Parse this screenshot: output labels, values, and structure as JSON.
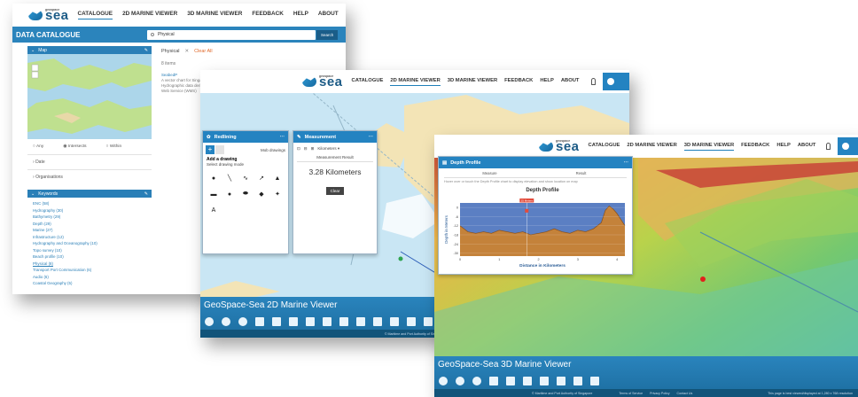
{
  "logo": {
    "small": "geospace",
    "big": "sea"
  },
  "nav": {
    "catalogue": "CATALOGUE",
    "viewer2d": "2D MARINE VIEWER",
    "viewer3d": "3D MARINE VIEWER",
    "feedback": "FEEDBACK",
    "help": "HELP",
    "about": "ABOUT"
  },
  "catalogue": {
    "title": "DATA CATALOGUE",
    "search_value": "Physical",
    "search_button": "Search",
    "filter_chip": "Physical",
    "clear_all": "Clear All",
    "items_count": "8 items",
    "result_title": "SeabedP",
    "result_lines": [
      "A vector chart for Singapore port",
      "Hydrographic data derived",
      "Web Service (WMS)"
    ],
    "map_section": "Map",
    "radio_any": "Any",
    "radio_intersects": "Intersects",
    "radio_within": "Within",
    "date_section": "Date",
    "org_section": "Organisations",
    "keywords_section": "Keywords",
    "keywords": [
      "ENC (58)",
      "Hydrography (30)",
      "Bathymetry (29)",
      "Depth (29)",
      "Marine (27)",
      "Infrastructure (12)",
      "Hydrography and Oceanography (10)",
      "Topo survey (10)",
      "Beach profile (10)",
      "Physical (8)",
      "Transport Port Communication (6)",
      "Audio (6)",
      "Coastal Geography (5)"
    ]
  },
  "viewer2d": {
    "title": "GeoSpace-Sea 2D Marine Viewer",
    "redlining": {
      "title": "Redlining",
      "my_drawings": "Mob drawings",
      "add": "Add a drawing",
      "mode": "Select drawing mode"
    },
    "measurement": {
      "title": "Measurement",
      "unit": "Kilometers",
      "result_label": "Measurement Result",
      "result": "3.28 Kilometers",
      "clear": "Clear"
    },
    "footer": "© Maritime and Port Authority of Singapore"
  },
  "viewer3d": {
    "title": "GeoSpace-Sea 3D Marine Viewer",
    "depth": {
      "panel_title": "Depth Profile",
      "col_measure": "Measure",
      "col_result": "Result",
      "hint": "Hover over or touch the Depth Profile chart to display elevation and show location on map",
      "chart_title": "Depth Profile",
      "xlabel": "Distance in Kilometers",
      "ylabel": "Depth in Meters",
      "marker_label": "25 Meters"
    },
    "footer_left": "© Maritime and Port Authority of Singapore",
    "footer_links": [
      "Terms of Service",
      "Privacy Policy",
      "Contact Us"
    ],
    "footer_right": "This page is best viewed/displayed at 1,280 x 768 resolution"
  },
  "chart_data": {
    "type": "area",
    "title": "Depth Profile",
    "xlabel": "Distance in Kilometers",
    "ylabel": "Depth in Meters",
    "x_ticks": [
      0,
      1,
      2,
      3,
      4
    ],
    "y_ticks": [
      0,
      -6,
      -12,
      -18,
      -24,
      -30
    ],
    "xlim": [
      0,
      4.2
    ],
    "ylim": [
      -32,
      3
    ],
    "x": [
      0,
      0.2,
      0.4,
      0.6,
      0.8,
      1.0,
      1.2,
      1.4,
      1.6,
      1.8,
      2.0,
      2.2,
      2.4,
      2.6,
      2.8,
      3.0,
      3.2,
      3.4,
      3.6,
      3.7,
      3.8,
      3.9,
      4.0,
      4.1,
      4.2
    ],
    "y": [
      -12,
      -16,
      -17,
      -16,
      -17,
      -15,
      -16,
      -17,
      -16,
      -18,
      -17,
      -16,
      -14,
      -16,
      -17,
      -15,
      -16,
      -14,
      -10,
      -2,
      1,
      -1,
      -4,
      -8,
      -12
    ]
  }
}
